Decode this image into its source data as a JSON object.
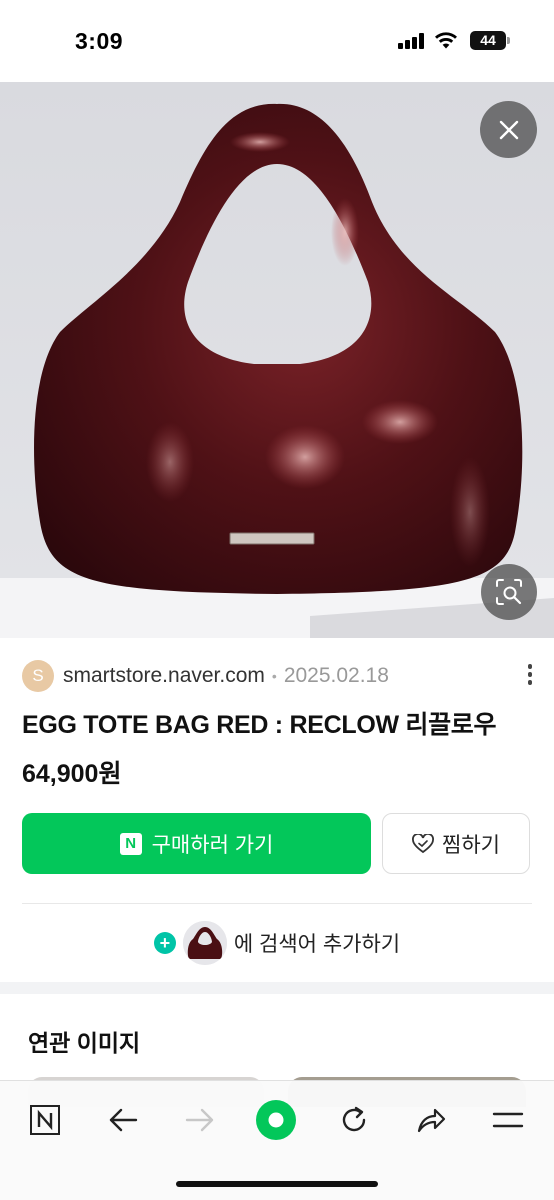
{
  "status_bar": {
    "time": "3:09",
    "battery": "44"
  },
  "hero": {
    "close_icon": "close-icon",
    "lens_icon": "image-search-icon"
  },
  "product": {
    "source_initial": "S",
    "source_domain": "smartstore.naver.com",
    "separator": "•",
    "date": "2025.02.18",
    "title": "EGG TOTE BAG RED : RECLOW 리끌로우",
    "price": "64,900원"
  },
  "actions": {
    "buy_badge": "N",
    "buy_label": "구매하러 가기",
    "wish_label": "찜하기",
    "add_search_plus": "+",
    "add_search_label": "에 검색어 추가하기"
  },
  "related": {
    "title": "연관 이미지"
  },
  "toolbar": {
    "home_label": "N",
    "items": [
      "naver-home-icon",
      "back-arrow-icon",
      "forward-arrow-icon",
      "green-dot-icon",
      "refresh-icon",
      "share-icon",
      "menu-icon"
    ]
  },
  "colors": {
    "accent_green": "#03c75a",
    "bag": "#4a0f13",
    "plus_teal": "#00c4a7"
  }
}
